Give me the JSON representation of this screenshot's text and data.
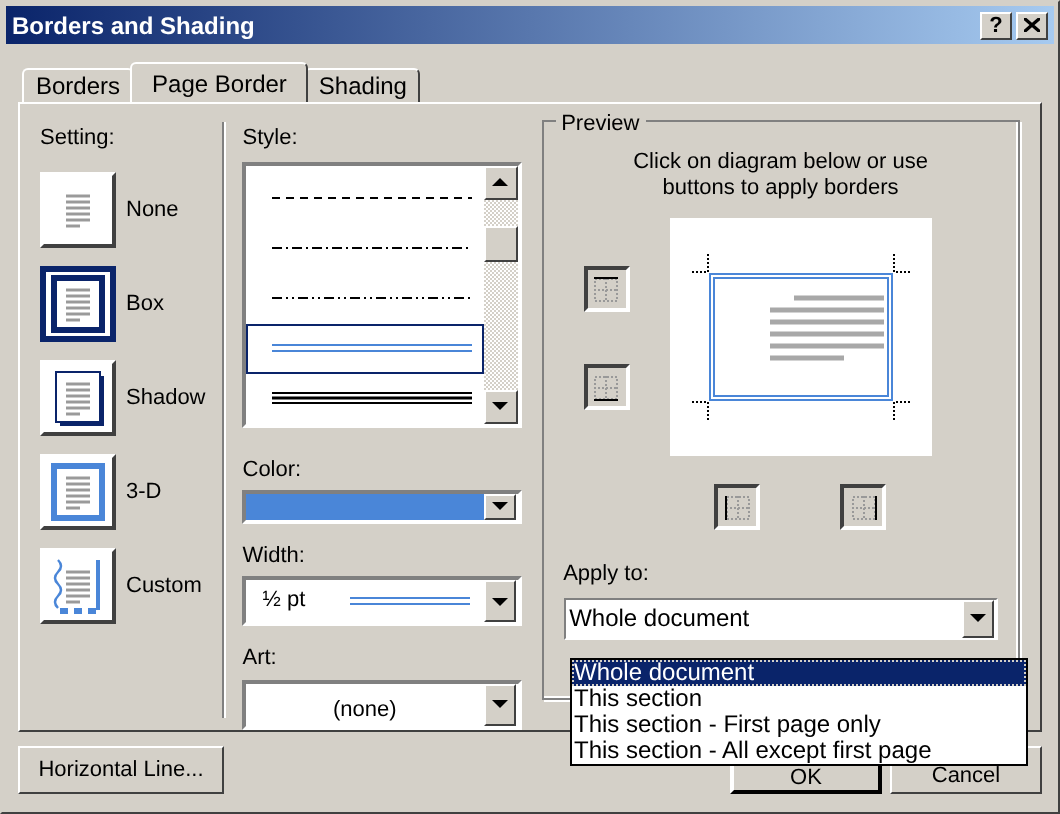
{
  "window": {
    "title": "Borders and Shading",
    "help": "?"
  },
  "tabs": [
    {
      "label": "Borders",
      "selected": false
    },
    {
      "label": "Page Border",
      "selected": true
    },
    {
      "label": "Shading",
      "selected": false
    }
  ],
  "setting": {
    "label": "Setting:",
    "options": [
      {
        "label": "None",
        "kind": "none",
        "selected": false
      },
      {
        "label": "Box",
        "kind": "box",
        "selected": true
      },
      {
        "label": "Shadow",
        "kind": "shadow",
        "selected": false
      },
      {
        "label": "3-D",
        "kind": "three-d",
        "selected": false
      },
      {
        "label": "Custom",
        "kind": "custom",
        "selected": false
      }
    ]
  },
  "style": {
    "label": "Style:",
    "options": [
      {
        "kind": "dashed",
        "selected": false
      },
      {
        "kind": "dash-dot",
        "selected": false
      },
      {
        "kind": "dash-dot-dot",
        "selected": false
      },
      {
        "kind": "double",
        "selected": true
      },
      {
        "kind": "triple",
        "selected": false
      }
    ]
  },
  "color": {
    "label": "Color:",
    "color": "#4a86d8"
  },
  "width": {
    "label": "Width:",
    "value": "½ pt"
  },
  "art": {
    "label": "Art:",
    "value": "(none)"
  },
  "preview": {
    "legend": "Preview",
    "instruction": "Click on diagram below or use buttons to apply borders",
    "edge_buttons": [
      {
        "kind": "top"
      },
      {
        "kind": "bottom"
      },
      {
        "kind": "left"
      },
      {
        "kind": "right"
      }
    ]
  },
  "apply_to": {
    "label": "Apply to:",
    "value": "Whole document",
    "expanded": true,
    "options": [
      {
        "label": "Whole document",
        "selected": true
      },
      {
        "label": "This section",
        "selected": false
      },
      {
        "label": "This section - First page only",
        "selected": false
      },
      {
        "label": "This section - All except first page",
        "selected": false
      }
    ]
  },
  "buttons": [
    {
      "label": "Horizontal Line..."
    },
    {
      "label": "OK"
    },
    {
      "label": "Cancel"
    }
  ]
}
